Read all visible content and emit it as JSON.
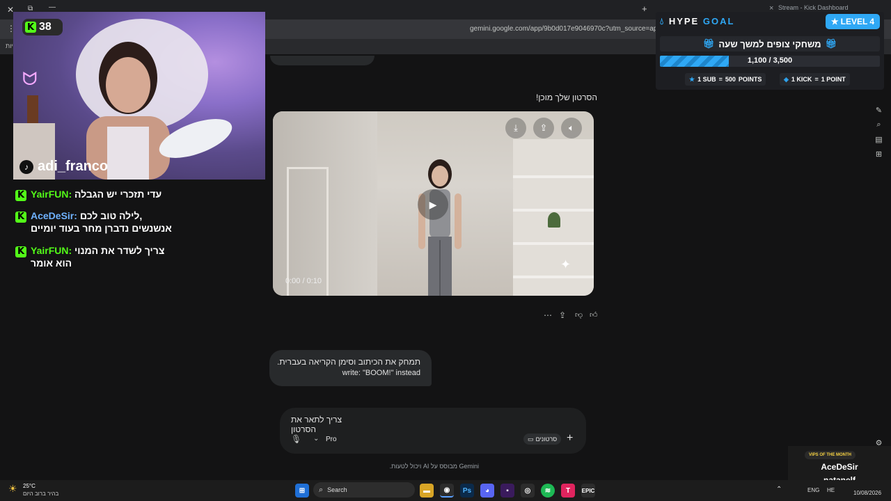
{
  "browser": {
    "url": "gemini.google.com/app/9b0d017e9046970c?utm_source=app_launcher&utm_medium=owned&utm_campaign=base_all",
    "tabs": [
      {
        "label": "Stream - Kick Dashboard"
      }
    ],
    "bookmark_fragment": "יות",
    "tab_close": "×",
    "new_tab": "+",
    "window_close": "✕",
    "window_restore": "⧉",
    "window_min": "—"
  },
  "gemini": {
    "response_text": "הסרטון שלך מוכן!",
    "video": {
      "timecode": "0:00 / 0:10"
    },
    "user_message_line1": "תמחק את הכיתוב וסימן הקריאה בעברית.",
    "user_message_line2": "write: \"BOOM!\" instead",
    "prompt_text": "צריך לתאר את הסרטון",
    "model_label": "Pro",
    "tool_chip_label": "סרטונים",
    "disclaimer": "Gemini מבוסס על AI ויכול לטעות."
  },
  "stream_overlay": {
    "viewer_count": "38",
    "streamer_handle": "adi_franco",
    "chat": [
      {
        "user": "YairFUN:",
        "message": "עדי תזכרי יש הגבלה",
        "color": "#53fc18"
      },
      {
        "user": "AceDeSir:",
        "message": "לילה טוב לכם,",
        "message2": "אנשנשים נדברן מחר בעוד יומיים",
        "color": "#6fb2ff"
      },
      {
        "user": "YairFUN:",
        "message": "צריך לשדר את המנוי",
        "message2": "הוא אומר",
        "color": "#53fc18"
      }
    ],
    "hype_goal": {
      "title_a": "HYPE",
      "title_b": "GOAL",
      "level": "LEVEL 4",
      "subtitle": "משחקי צופים למשך שעה",
      "progress_text": "1,100 / 3,500",
      "progress_fraction": 0.314,
      "sub_rule_pre": "1 SUB",
      "sub_rule_eq": "=",
      "sub_rule_points": "500",
      "sub_rule_post": "POINTS",
      "kick_rule_pre": "1 KICK",
      "kick_rule_eq": "=",
      "kick_rule_post": "1 POINT"
    },
    "vips": {
      "header": "VIPS OF THE MONTH",
      "name1": "AceDeSir",
      "name2": "natanelf"
    }
  },
  "taskbar": {
    "weather_temp": "25°C",
    "weather_desc": "בהיר ברוב היום",
    "search_placeholder": "Search",
    "lang": "ENG",
    "date": "10/08/2026",
    "lang2": "HE"
  },
  "colors": {
    "kick_green": "#53fc18",
    "hype_blue": "#2fa8f5",
    "gemini_bg": "#131314"
  }
}
